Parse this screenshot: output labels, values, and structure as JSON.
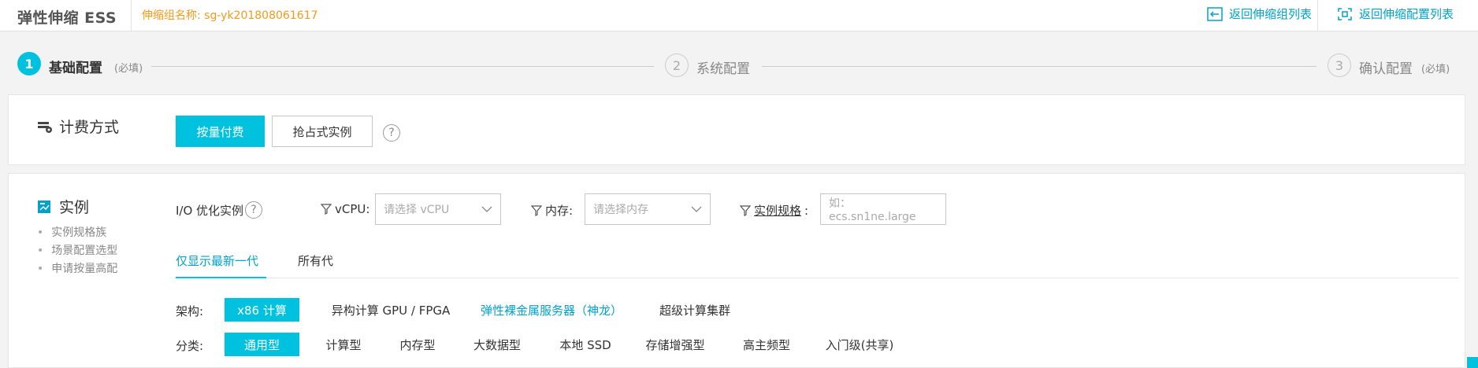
{
  "header": {
    "app_title": "弹性伸缩 ESS",
    "group_name": "伸缩组名称: sg-yk201808061617",
    "links": [
      {
        "label": "返回伸缩组列表",
        "icon": "return-arrow-icon"
      },
      {
        "label": "返回伸缩配置列表",
        "icon": "config-return-icon"
      }
    ]
  },
  "steps": [
    {
      "num": "1",
      "label": "基础配置",
      "note": "(必填)",
      "active": true
    },
    {
      "num": "2",
      "label": "系统配置",
      "note": "",
      "active": false
    },
    {
      "num": "3",
      "label": "确认配置",
      "note": "(必填)",
      "active": false
    }
  ],
  "billing": {
    "title": "计费方式",
    "icon": "billing-icon",
    "options": [
      "按量付费",
      "抢占式实例"
    ],
    "selected": "按量付费",
    "help": "?"
  },
  "instance": {
    "title": "实例",
    "icon": "instance-icon",
    "sublinks": [
      "实例规格族",
      "场景配置选型",
      "申请按量高配"
    ],
    "io_label": "I/O 优化实例",
    "help": "?",
    "filters": {
      "vcpu": {
        "label": "vCPU:",
        "placeholder": "请选择 vCPU"
      },
      "memory": {
        "label": "内存:",
        "placeholder": "请选择内存"
      },
      "spec": {
        "label": "实例规格",
        "colon": ":",
        "placeholder": "如：ecs.sn1ne.large"
      }
    },
    "tabs": [
      "仅显示最新一代",
      "所有代"
    ],
    "active_tab": "仅显示最新一代",
    "arch": {
      "label": "架构:",
      "options": [
        "x86 计算",
        "异构计算 GPU / FPGA",
        "弹性裸金属服务器（神龙）",
        "超级计算集群"
      ],
      "selected": "x86 计算"
    },
    "category": {
      "label": "分类:",
      "options": [
        "通用型",
        "计算型",
        "内存型",
        "大数据型",
        "本地 SSD",
        "存储增强型",
        "高主频型",
        "入门级(共享)"
      ],
      "selected": "通用型"
    }
  },
  "colors": {
    "accent": "#00c1de",
    "link": "#00a2ca",
    "orange": "#f39a1b"
  }
}
